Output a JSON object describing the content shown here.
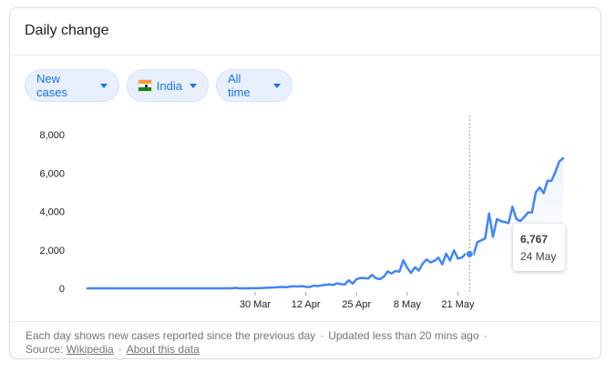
{
  "card": {
    "title": "Daily change"
  },
  "filters": {
    "metric": {
      "label": "New cases",
      "icon": "chevron-down-icon"
    },
    "region": {
      "label": "India",
      "icon": "india-flag-icon"
    },
    "range": {
      "label": "All time",
      "icon": "chevron-down-icon"
    }
  },
  "tooltip": {
    "value": "6,767",
    "date": "24 May"
  },
  "footer": {
    "note": "Each day shows new cases reported since the previous day",
    "updated": "Updated less than 20 mins ago",
    "source_label": "Source:",
    "source_link": "Wikipedia",
    "about_link": "About this data"
  },
  "colors": {
    "line": "#4285f4",
    "accent": "#1a73e8",
    "chip_bg": "#e8f0fe"
  },
  "chart_data": {
    "type": "area",
    "title": "",
    "xlabel": "",
    "ylabel": "",
    "ylim": [
      0,
      8000
    ],
    "y_ticks": [
      0,
      2000,
      4000,
      6000,
      8000
    ],
    "y_tick_labels": [
      "0",
      "2,000",
      "4,000",
      "6,000",
      "8,000"
    ],
    "x_tick_labels": [
      "30 Mar",
      "12 Apr",
      "25 Apr",
      "8 May",
      "21 May"
    ],
    "x_tick_indices": [
      43,
      56,
      69,
      82,
      95
    ],
    "start_date": "2020-01-30",
    "grid": false,
    "highlight_index": 98,
    "series": [
      {
        "values": [
          1,
          0,
          0,
          0,
          0,
          0,
          0,
          0,
          0,
          0,
          0,
          0,
          0,
          0,
          0,
          0,
          0,
          0,
          0,
          0,
          0,
          0,
          0,
          0,
          0,
          0,
          0,
          0,
          0,
          0,
          0,
          0,
          0,
          1,
          0,
          0,
          3,
          1,
          25,
          0,
          0,
          1,
          3,
          5,
          10,
          20,
          30,
          40,
          45,
          60,
          70,
          55,
          90,
          110,
          95,
          120,
          75,
          65,
          140,
          120,
          150,
          180,
          210,
          170,
          260,
          220,
          200,
          420,
          240,
          480,
          540,
          530,
          510,
          700,
          520,
          480,
          600,
          880,
          770,
          900,
          870,
          1460,
          1070,
          800,
          1100,
          920,
          1300,
          1500,
          1350,
          1430,
          1600,
          1250,
          1800,
          1450,
          1980,
          1550,
          1600,
          1800,
          1780,
          1750,
          2400,
          2500,
          2600,
          3900,
          2680,
          3600,
          3500,
          3450,
          3400,
          4250,
          3600,
          3500,
          3700,
          3950,
          3950,
          5000,
          5250,
          4950,
          5600,
          5600,
          6050,
          6600,
          6767
        ]
      }
    ]
  }
}
